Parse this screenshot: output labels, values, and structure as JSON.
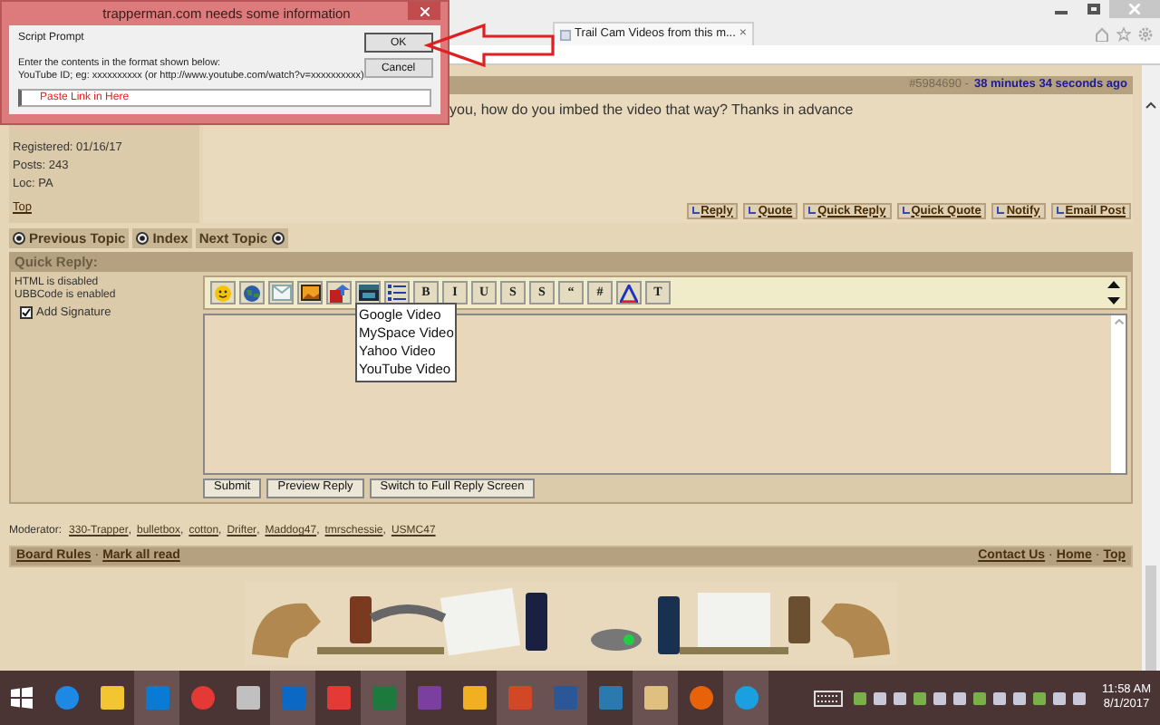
{
  "browser": {
    "tab_title": "Trail Cam Videos from this m...",
    "tab_close": "×"
  },
  "post": {
    "number": "#5984690 -",
    "time": "38 minutes 34 seconds ago",
    "user": {
      "registered": "Registered: 01/16/17",
      "posts": "Posts: 243",
      "location": "Loc: PA",
      "top_link": "Top"
    },
    "body": "you, how do you imbed the video that way? Thanks in advance",
    "actions": [
      "Reply",
      "Quote",
      "Quick Reply",
      "Quick Quote",
      "Notify",
      "Email Post"
    ]
  },
  "nav": [
    {
      "label": "Previous Topic",
      "kind": "leading"
    },
    {
      "label": "Index",
      "kind": "leading"
    },
    {
      "label": "Next Topic",
      "kind": "trailing"
    }
  ],
  "quick_reply": {
    "title": "Quick Reply:",
    "html_status": "HTML is disabled",
    "ubb_status": "UBBCode is enabled",
    "signature": {
      "label": "Add Signature",
      "checked": true
    },
    "toolbar": [
      {
        "kind": "icon"
      },
      {
        "kind": "icon"
      },
      {
        "kind": "icon"
      },
      {
        "kind": "icon"
      },
      {
        "kind": "icon"
      },
      {
        "kind": "icon"
      },
      {
        "kind": "icon"
      },
      {
        "kind": "text",
        "label": "B"
      },
      {
        "kind": "text",
        "label": "I"
      },
      {
        "kind": "text",
        "label": "U"
      },
      {
        "kind": "text",
        "label": "S"
      },
      {
        "kind": "text",
        "label": "S"
      },
      {
        "kind": "text",
        "label": "“"
      },
      {
        "kind": "text",
        "label": "#"
      },
      {
        "kind": "icon"
      },
      {
        "kind": "text",
        "label": "T"
      }
    ],
    "video_menu": [
      "Google Video",
      "MySpace Video",
      "Yahoo Video",
      "YouTube Video"
    ],
    "buttons": [
      "Submit",
      "Preview Reply",
      "Switch to Full Reply Screen"
    ]
  },
  "moderators": {
    "label": "Moderator:",
    "separator": ",",
    "names": [
      "330-Trapper",
      "bulletbox",
      "cotton",
      "Drifter",
      "Maddog47",
      "tmrschessie",
      "USMC47"
    ]
  },
  "footer": {
    "separator": "·",
    "left": [
      "Board Rules",
      "Mark all read"
    ],
    "right": [
      "Contact Us",
      "Home",
      "Top"
    ]
  },
  "dialog": {
    "title": "trapperman.com needs some information",
    "heading": "Script Prompt",
    "message_lines": [
      "Enter the contents in the format shown below:",
      "YouTube ID; eg: xxxxxxxxxx (or http://www.youtube.com/watch?v=xxxxxxxxxx)"
    ],
    "value": "Paste Link in Here",
    "buttons": [
      "OK",
      "Cancel"
    ]
  },
  "taskbar": {
    "time": "11:58 AM",
    "date": "8/1/2017"
  }
}
